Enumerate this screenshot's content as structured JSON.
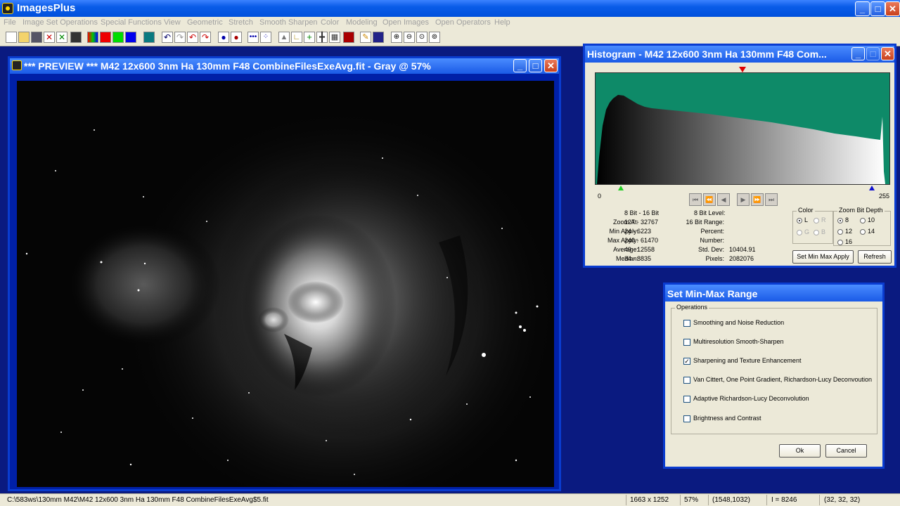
{
  "app": {
    "title": "ImagesPlus"
  },
  "menu": [
    "File",
    "Image Set Operations",
    "Special Functions",
    "View",
    "Geometric",
    "Stretch",
    "Smooth Sharpen",
    "Color",
    "Modeling",
    "Open Images",
    "Open Operators",
    "Help"
  ],
  "preview": {
    "title": "*** PREVIEW *** M42 12x600 3nm Ha 130mm F48 CombineFilesExeAvg.fit - Gray @ 57%"
  },
  "histogram": {
    "title": "Histogram - M42 12x600 3nm Ha 130mm F48 Com...",
    "range_min": "0",
    "range_max": "255",
    "header_col1": "8 Bit - 16 Bit",
    "header_col2": "8 Bit Level:",
    "stats_left": [
      {
        "label": "Zoom At:",
        "value": "127 - 32767"
      },
      {
        "label": "Min Apply:",
        "value": "24 - 6223"
      },
      {
        "label": "Max Apply:",
        "value": "240 - 61470"
      },
      {
        "label": "Average:",
        "value": "49 - 12558"
      },
      {
        "label": "Median:",
        "value": "34 - 8835"
      }
    ],
    "stats_right": [
      {
        "label": "16 Bit Range:",
        "value": ""
      },
      {
        "label": "Percent:",
        "value": ""
      },
      {
        "label": "Number:",
        "value": ""
      },
      {
        "label": "Std. Dev:",
        "value": "10404.91"
      },
      {
        "label": "Pixels:",
        "value": "2082076"
      }
    ],
    "color_group": {
      "label": "Color",
      "options": [
        "L",
        "R",
        "G",
        "B"
      ],
      "selected": "L"
    },
    "zoom_group": {
      "label": "Zoom Bit Depth",
      "options": [
        "8",
        "10",
        "12",
        "14",
        "16"
      ],
      "selected": "8"
    },
    "btn_set_min_max": "Set Min Max Apply",
    "btn_refresh": "Refresh"
  },
  "dialog": {
    "title": "Set Min-Max Range",
    "group_label": "Operations",
    "options": [
      {
        "label": "Smoothing and Noise Reduction",
        "checked": false
      },
      {
        "label": "Multiresolution Smooth-Sharpen",
        "checked": false
      },
      {
        "label": "Sharpening and Texture Enhancement",
        "checked": true
      },
      {
        "label": "Van Cittert, One Point Gradient,  Richardson-Lucy Deconvoution",
        "checked": false
      },
      {
        "label": "Adaptive Richardson-Lucy Deconvolution",
        "checked": false
      },
      {
        "label": "Brightness and Contrast",
        "checked": false
      }
    ],
    "ok": "Ok",
    "cancel": "Cancel"
  },
  "status": {
    "path": "C:\\583ws\\130mm M42\\M42 12x600 3nm Ha 130mm F48 CombineFilesExeAvg$5.fit",
    "dimensions": "1663 x 1252",
    "zoom": "57%",
    "cursor": "(1548,1032)",
    "intensity": "I = 8246",
    "rgb": "(32, 32, 32)"
  }
}
